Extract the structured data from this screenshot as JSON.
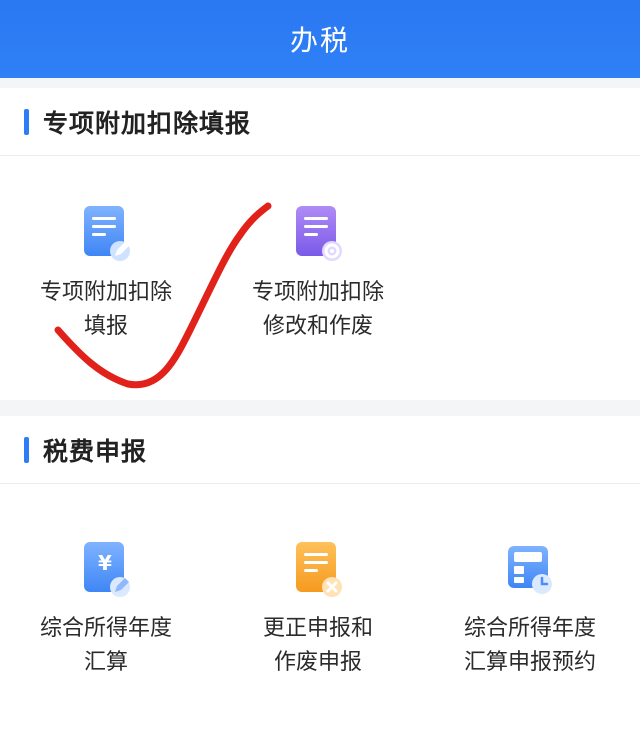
{
  "header": {
    "title": "办税"
  },
  "section_deduction": {
    "title": "专项附加扣除填报",
    "items": [
      {
        "line1": "专项附加扣除",
        "line2": "填报"
      },
      {
        "line1": "专项附加扣除",
        "line2": "修改和作废"
      }
    ]
  },
  "section_tax": {
    "title": "税费申报",
    "items": [
      {
        "line1": "综合所得年度",
        "line2": "汇算"
      },
      {
        "line1": "更正申报和",
        "line2": "作废申报"
      },
      {
        "line1": "综合所得年度",
        "line2": "汇算申报预约"
      }
    ]
  },
  "colors": {
    "header_blue": "#2f80f6",
    "accent_bar": "#2f7df6",
    "annotation_red": "#e0221a"
  }
}
